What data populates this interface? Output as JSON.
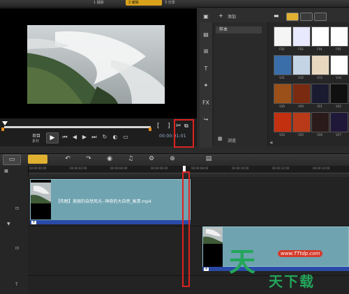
{
  "topbar": {
    "step1_label": "1 捕获",
    "step2_label": "2 编辑",
    "step3_label": "3 分享"
  },
  "player": {
    "project_label": "项目",
    "clip_label": "素材",
    "timecode": "00:00:01:01",
    "mode_icons": [
      "bracket-in-icon",
      "bracket-out-icon",
      "scissors-icon",
      "copy-icon"
    ]
  },
  "library": {
    "add_label": "添加",
    "sample_folder": "样本",
    "browse_label": "浏览",
    "thumbnails": [
      {
        "label": "F02",
        "color": "#f5f5f5"
      },
      {
        "label": "F03",
        "color": "#e8e8ff"
      },
      {
        "label": "F04",
        "color": "#ffffff"
      },
      {
        "label": "F05",
        "color": "#fdfdfd"
      },
      {
        "label": "V11",
        "color": "#3a6ea8"
      },
      {
        "label": "V12",
        "color": "#c4d4e4"
      },
      {
        "label": "V13",
        "color": "#e8d8c0"
      },
      {
        "label": "V14",
        "color": "#ffffff"
      },
      {
        "label": "V20",
        "color": "#9a5018"
      },
      {
        "label": "V29",
        "color": "#7a2a10"
      },
      {
        "label": "V21",
        "color": "#1a1a30"
      },
      {
        "label": "V22",
        "color": "#101010"
      },
      {
        "label": "V24",
        "color": "#c23010"
      },
      {
        "label": "V25",
        "color": "#b83a18"
      },
      {
        "label": "V26",
        "color": "#2a1a1a"
      },
      {
        "label": "V27",
        "color": "#201838"
      }
    ]
  },
  "timeline": {
    "ruler_labels": [
      "00:00:00:00",
      "00:00:02:00",
      "00:00:04:00",
      "00:00:06:00",
      "00:00:08:00",
      "00:00:10:00",
      "00:00:12:00",
      "00:00:14:00"
    ],
    "clip1_label": "【失眠】美丽的自然风光--神奇的大自然_高清.mp4"
  },
  "watermark": {
    "big_char": "天",
    "url": "www.TTtdp.com",
    "text": "天下载"
  },
  "colors": {
    "accent": "#e0b030",
    "clip": "#6fa3b0",
    "clip_bar": "#2a4aa8",
    "highlight": "#dd2222",
    "watermark_green": "#23a55a"
  }
}
